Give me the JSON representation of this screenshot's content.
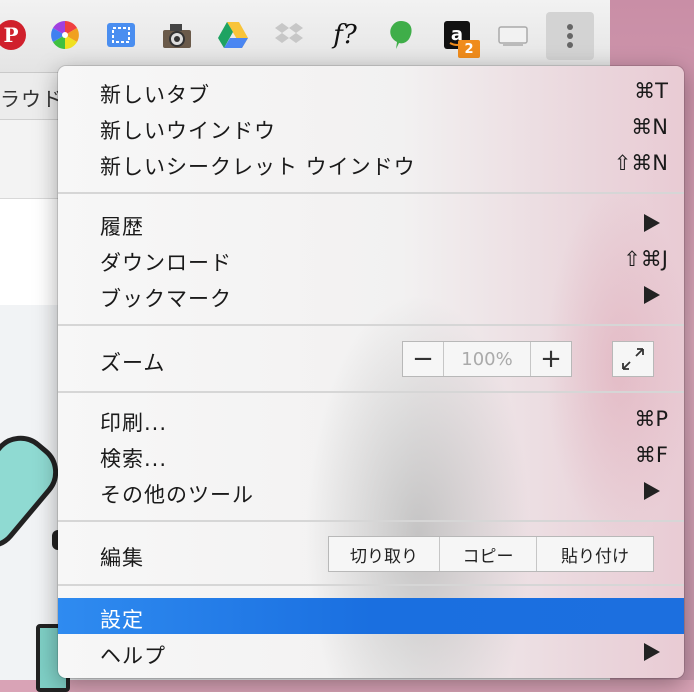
{
  "toolbar": {
    "extensions": [
      {
        "icon": "pinterest-icon",
        "color": "#d0202c"
      },
      {
        "icon": "color-wheel-icon",
        "color": "#e04040"
      },
      {
        "icon": "window-resizer-icon",
        "color": "#4a8ef0"
      },
      {
        "icon": "camera-icon",
        "color": "#555555"
      },
      {
        "icon": "google-drive-icon",
        "color": "#2aa36b"
      },
      {
        "icon": "dropbox-icon",
        "color": "#bfbfbf"
      },
      {
        "icon": "font-finder-icon",
        "glyph": "f?",
        "color": "#111111"
      },
      {
        "icon": "evernote-leaf-icon",
        "color": "#3fae49"
      },
      {
        "icon": "amazon-icon",
        "glyph": "a",
        "color": "#111111"
      },
      {
        "icon": "screen-capture-icon",
        "color": "#aaaaaa"
      }
    ],
    "amazon_badge": "2",
    "menu_icon": "more-vertical-icon"
  },
  "bookmarks_bar": {
    "partial_text": "ラウド"
  },
  "menu": {
    "groups": [
      {
        "items": [
          {
            "label": "新しいタブ",
            "shortcut": "⌘T"
          },
          {
            "label": "新しいウインドウ",
            "shortcut": "⌘N"
          },
          {
            "label": "新しいシークレット ウインドウ",
            "shortcut": "⇧⌘N"
          }
        ]
      },
      {
        "items": [
          {
            "label": "履歴",
            "submenu": true
          },
          {
            "label": "ダウンロード",
            "shortcut": "⇧⌘J"
          },
          {
            "label": "ブックマーク",
            "submenu": true
          }
        ]
      },
      {
        "zoom": {
          "label": "ズーム",
          "minus": "−",
          "value": "100%",
          "plus": "+",
          "fullscreen_icon": "fullscreen-icon"
        }
      },
      {
        "items": [
          {
            "label": "印刷...",
            "shortcut": "⌘P"
          },
          {
            "label": "検索...",
            "shortcut": "⌘F"
          },
          {
            "label": "その他のツール",
            "submenu": true
          }
        ]
      },
      {
        "edit": {
          "label": "編集",
          "cut": "切り取り",
          "copy": "コピー",
          "paste": "貼り付け"
        }
      },
      {
        "items": [
          {
            "label": "設定",
            "highlighted": true
          },
          {
            "label": "ヘルプ",
            "submenu": true
          }
        ]
      }
    ]
  },
  "colors": {
    "highlight": "#1a6fe0",
    "badge": "#f08c1c"
  }
}
